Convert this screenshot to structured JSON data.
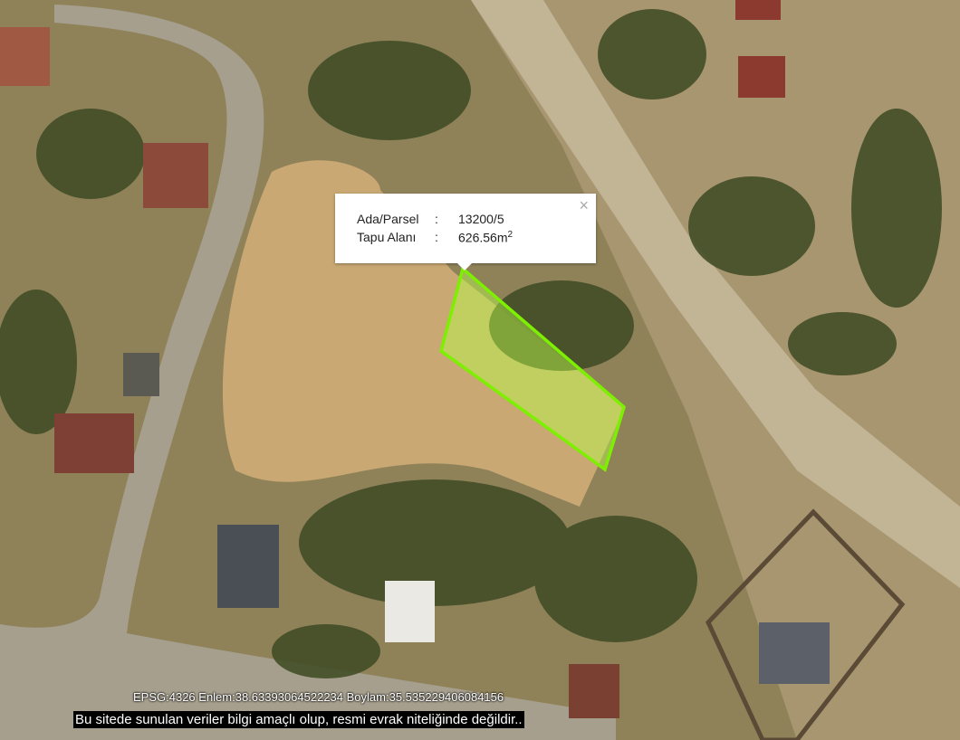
{
  "popup": {
    "rows": [
      {
        "key": "Ada/Parsel",
        "sep": ":",
        "value": "13200/5"
      },
      {
        "key": "Tapu Alanı",
        "sep": ":",
        "value": "626.56m",
        "unit_sup": "2"
      }
    ],
    "close_symbol": "×"
  },
  "coordinates_text": "EPSG:4326 Enlem:38.63393064522234 Boylam:35.535229406084156",
  "disclaimer": "Bu sitede sunulan veriler bilgi amaçlı olup, resmi evrak niteliğinde değildir..",
  "colors": {
    "parcel_outline": "#7cf000",
    "parcel_fill": "#b8ff4a",
    "ground": "#9a8a62",
    "field": "#c8a86e",
    "vegetation": "#3d4a22",
    "roof_red": "#8c4a3a",
    "road": "#b0aa9a"
  }
}
